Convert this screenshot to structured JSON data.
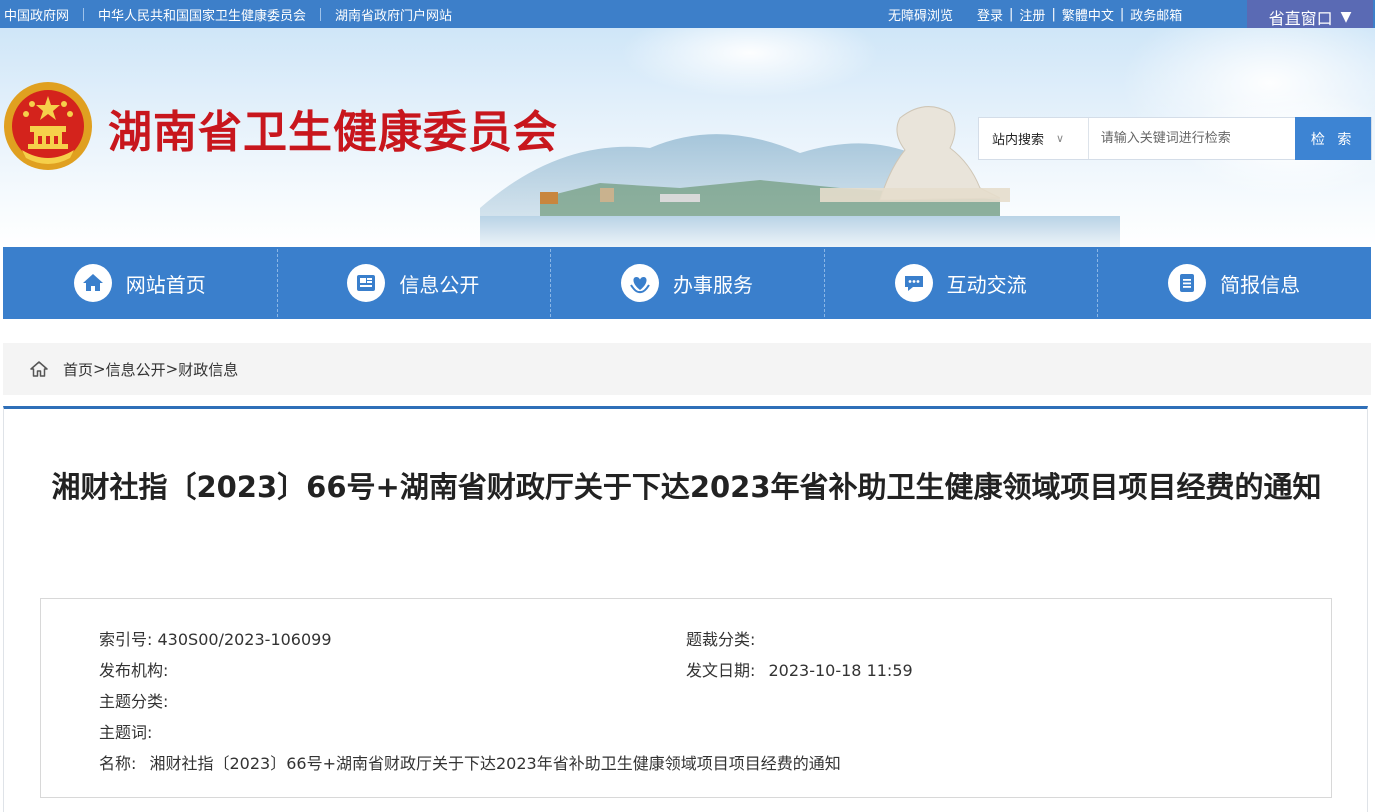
{
  "topbar": {
    "links": [
      "中国政府网",
      "中华人民共和国国家卫生健康委员会",
      "湖南省政府门户网站"
    ],
    "accessibility": "无障碍浏览",
    "login": "登录",
    "register": "注册",
    "traditional": "繁體中文",
    "mail": "政务邮箱",
    "divider": "|",
    "province_window": "省直窗口",
    "province_arrow": "▼"
  },
  "header": {
    "site_title": "湖南省卫生健康委员会"
  },
  "search": {
    "scope": "站内搜索",
    "placeholder": "请输入关键词进行检索",
    "button": "检 索"
  },
  "nav": {
    "items": [
      {
        "label": "网站首页",
        "icon": "home-icon"
      },
      {
        "label": "信息公开",
        "icon": "news-icon"
      },
      {
        "label": "办事服务",
        "icon": "heart-hands-icon"
      },
      {
        "label": "互动交流",
        "icon": "chat-icon"
      },
      {
        "label": "简报信息",
        "icon": "document-icon"
      }
    ]
  },
  "breadcrumb": {
    "home": "首页",
    "sep": ">",
    "level2": "信息公开",
    "level3": "财政信息"
  },
  "article": {
    "title": "湘财社指〔2023〕66号+湖南省财政厅关于下达2023年省补助卫生健康领域项目项目经费的通知"
  },
  "meta": {
    "index_label": "索引号:",
    "index_value": "430S00/2023-106099",
    "genre_label": "题裁分类:",
    "genre_value": "",
    "publisher_label": "发布机构:",
    "publisher_value": "",
    "date_label": "发文日期:",
    "date_value": "2023-10-18 11:59",
    "topic_label": "主题分类:",
    "topic_value": "",
    "keyword_label": "主题词:",
    "keyword_value": "",
    "name_label": "名称:",
    "name_value": "湘财社指〔2023〕66号+湖南省财政厅关于下达2023年省补助卫生健康领域项目项目经费的通知"
  },
  "colors": {
    "topbar": "#3d7fc9",
    "nav": "#3a7fcc",
    "title_red": "#c8161d",
    "search_button": "#3d84d3",
    "province_window": "#5a6ab4"
  }
}
